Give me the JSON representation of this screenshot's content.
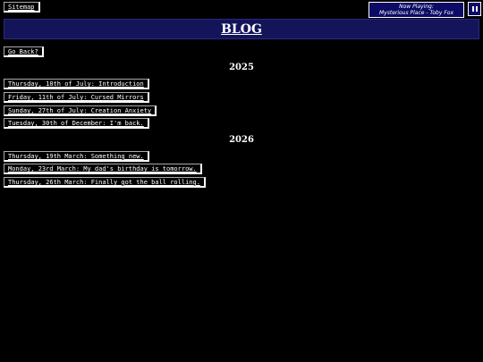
{
  "nav": {
    "sitemap_label": "Sitemap",
    "go_back_label": "Go Back?"
  },
  "player": {
    "now_playing_label": "Now Playing:",
    "track": "Mysterious Place - Toby Fox",
    "pause_icon": "pause-icon"
  },
  "header": {
    "title": "BLOG"
  },
  "sections": [
    {
      "year": "2025",
      "posts": [
        "Thursday, 10th of July: Introduction",
        "Friday, 11th of July: Cursed Mirrors",
        "Sunday, 27th of July: Creation Anxiety",
        "Tuesday, 30th of December: I'm back."
      ]
    },
    {
      "year": "2026",
      "posts": [
        "Thursday, 19th March: Something new.",
        "Monday, 23rd March: My dad's birthday is tomorrow.",
        "Thursday, 26th March: Finally got the ball rolling."
      ]
    }
  ],
  "colors": {
    "background": "#000000",
    "header_bar": "#14145a",
    "player_bg": "#0c0c66",
    "text": "#ffffff"
  }
}
